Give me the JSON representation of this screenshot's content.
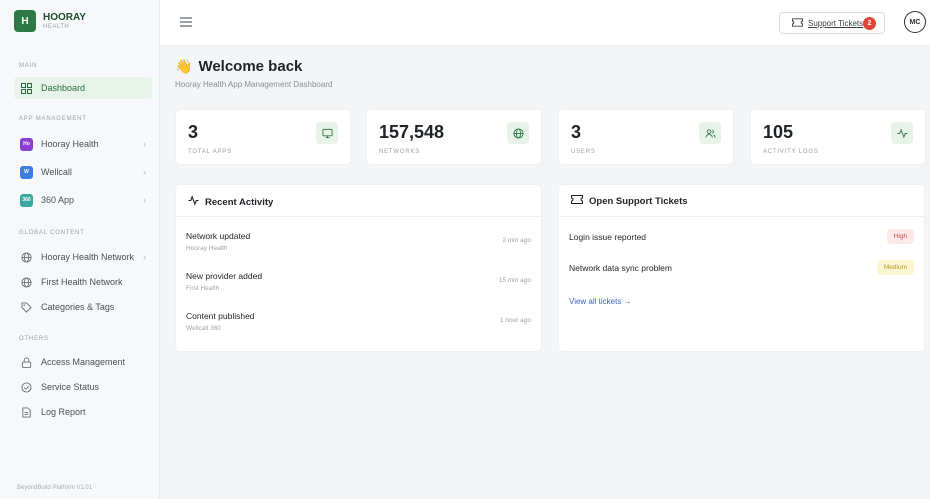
{
  "brand": {
    "logo_letter": "H",
    "name": "HOORAY",
    "sub": "HEALTH"
  },
  "sidebar": {
    "sections": {
      "main": "MAIN",
      "app_management": "APP MANAGEMENT",
      "global_content": "GLOBAL CONTENT",
      "others": "OTHERS"
    },
    "dashboard": "Dashboard",
    "apps": [
      {
        "label": "Hooray Health",
        "badge": "Ho",
        "color": "#8a3fd1"
      },
      {
        "label": "Wellcall",
        "badge": "W",
        "color": "#3b7de0"
      },
      {
        "label": "360 App",
        "badge": "360",
        "color": "#3aa7a0"
      }
    ],
    "global": [
      {
        "label": "Hooray Health Network",
        "icon": "globe-icon"
      },
      {
        "label": "First Health Network",
        "icon": "globe-icon"
      },
      {
        "label": "Categories & Tags",
        "icon": "tag-icon"
      }
    ],
    "others": [
      {
        "label": "Access Management",
        "icon": "lock-icon"
      },
      {
        "label": "Service Status",
        "icon": "check-circle-icon"
      },
      {
        "label": "Log Report",
        "icon": "document-icon"
      }
    ],
    "chevron": "›",
    "footer": "BeyondBuild Platform V1.01"
  },
  "topbar": {
    "support_label": "Support Tickets",
    "support_count": "2",
    "avatar": "MC"
  },
  "header": {
    "emoji": "👋",
    "title": "Welcome back",
    "subtitle": "Hooray Health App Management Dashboard"
  },
  "stats": [
    {
      "value": "3",
      "label": "TOTAL APPS",
      "icon": "monitor-icon"
    },
    {
      "value": "157,548",
      "label": "NETWORKS",
      "icon": "globe-icon"
    },
    {
      "value": "3",
      "label": "USERS",
      "icon": "users-icon"
    },
    {
      "value": "105",
      "label": "ACTIVITY LOGS",
      "icon": "activity-icon"
    }
  ],
  "recent_activity": {
    "title": "Recent Activity",
    "items": [
      {
        "title": "Network updated",
        "source": "Hooray Health",
        "time": "2 min ago"
      },
      {
        "title": "New provider added",
        "source": "First Health",
        "time": "15 min ago"
      },
      {
        "title": "Content published",
        "source": "Wellcall 360",
        "time": "1 hour ago"
      }
    ]
  },
  "support_tickets": {
    "title": "Open Support Tickets",
    "items": [
      {
        "title": "Login issue reported",
        "priority": "High"
      },
      {
        "title": "Network data sync problem",
        "priority": "Medium"
      }
    ],
    "view_all": "View all tickets →"
  },
  "colors": {
    "brand_green": "#2f7a44",
    "accent_light": "#e8f3ea",
    "badge_red": "#e0453a",
    "link_blue": "#3a66c4"
  }
}
